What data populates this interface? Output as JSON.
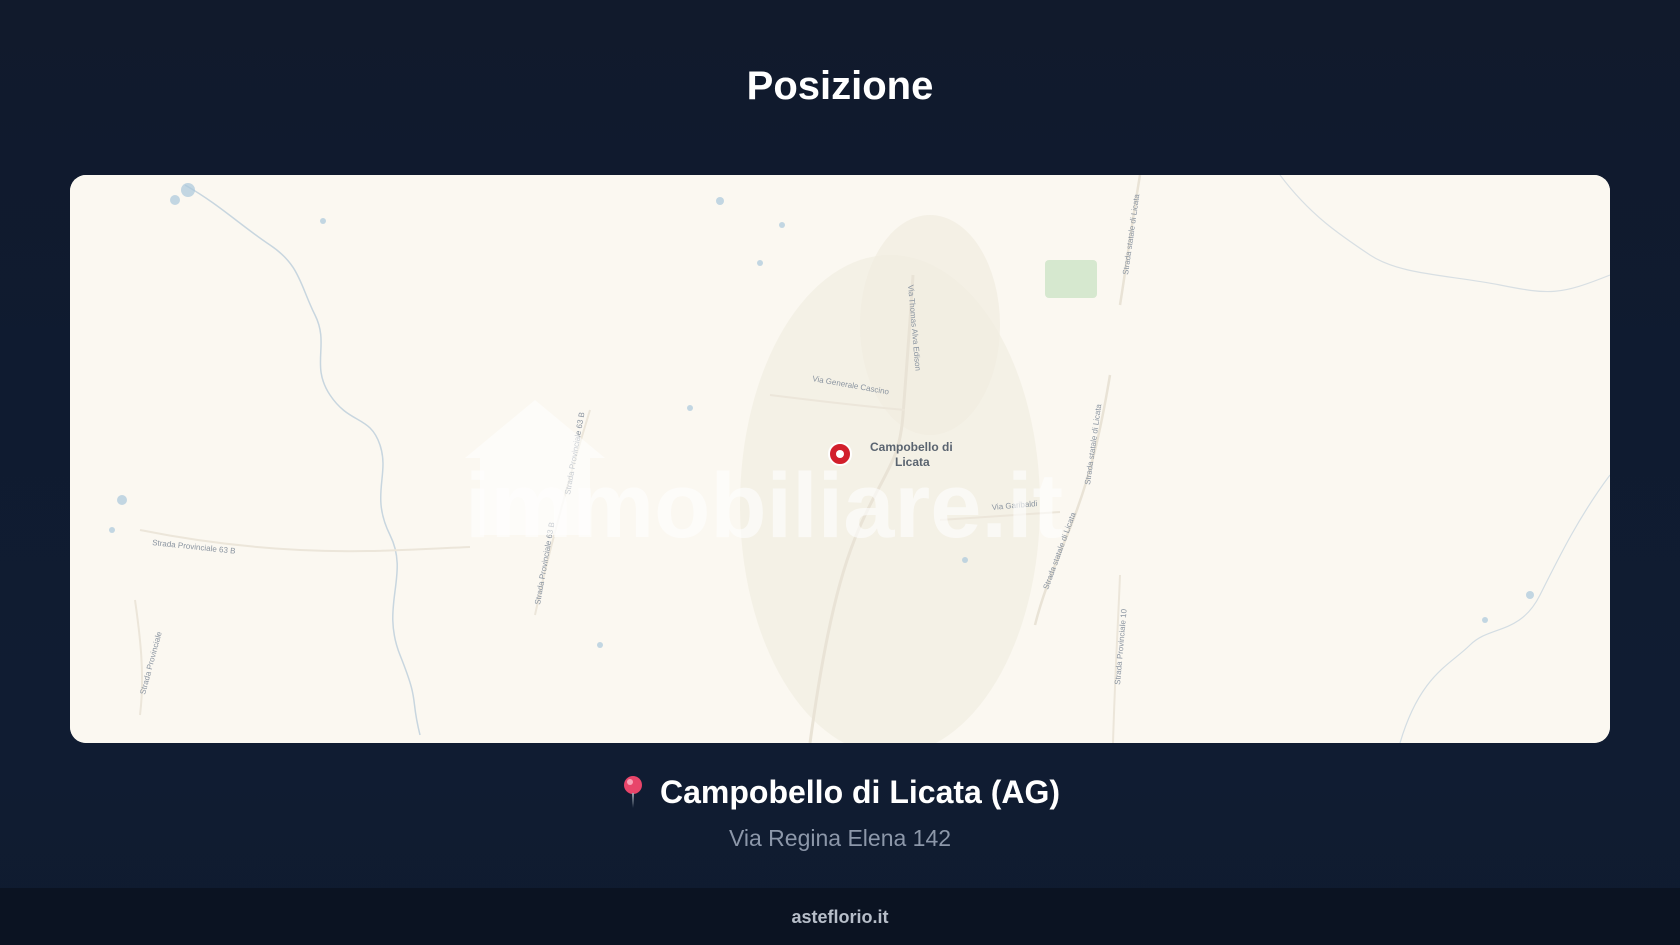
{
  "header": {
    "title": "Posizione"
  },
  "map": {
    "city_label_line1": "Campobello di",
    "city_label_line2": "Licata",
    "watermark": "immobiliare.it",
    "roads": {
      "via_thomas_alva_edison": "Via Thomas Alva Edison",
      "via_generale_cascino": "Via Generale Cascino",
      "via_garibaldi": "Via Garibaldi",
      "strada_statale_licata_1": "Strada statale di Licata",
      "strada_statale_licata_2": "Strada statale di Licata",
      "strada_statale_licata_3": "Strada statale di Licata",
      "strada_provinciale_63_a": "Strada Provinciale 63 B",
      "strada_provinciale_63_b": "Strada Provinciale 63 B",
      "strada_provinciale_63_c": "Strada Provinciale 63 B",
      "strada_provinciale_10": "Strada Provinciale 10",
      "strada_provinciale_left": "Strada Provinciale"
    },
    "colors": {
      "land": "#fbf8f1",
      "water": "#a9c7dc",
      "park": "#d6e8cf",
      "marker": "#d21f2b"
    }
  },
  "location": {
    "city": "Campobello di Licata (AG)",
    "address": "Via Regina Elena 142",
    "icon": "pin-icon"
  },
  "footer": {
    "text": "asteflorio.it"
  }
}
